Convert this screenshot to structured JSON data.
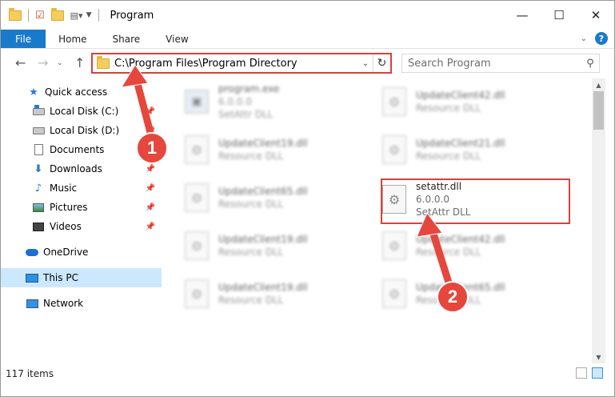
{
  "window": {
    "title": "Program",
    "minimize": "—",
    "maximize": "☐",
    "close": "✕"
  },
  "ribbon": {
    "tabs": [
      "File",
      "Home",
      "Share",
      "View"
    ],
    "collapse_icon": "chevron-down-icon",
    "help": "?"
  },
  "address": {
    "path": "C:\\Program Files\\Program Directory",
    "search_placeholder": "Search Program"
  },
  "sidebar": {
    "items": [
      {
        "label": "Quick access",
        "icon": "star-icon"
      },
      {
        "label": "Local Disk (C:)",
        "icon": "disk-c-icon",
        "pinned": true
      },
      {
        "label": "Local Disk (D:)",
        "icon": "disk-d-icon",
        "pinned": true
      },
      {
        "label": "Documents",
        "icon": "documents-icon",
        "pinned": true
      },
      {
        "label": "Downloads",
        "icon": "downloads-icon",
        "pinned": true
      },
      {
        "label": "Music",
        "icon": "music-icon",
        "pinned": true
      },
      {
        "label": "Pictures",
        "icon": "pictures-icon",
        "pinned": true
      },
      {
        "label": "Videos",
        "icon": "videos-icon",
        "pinned": true
      },
      {
        "label": "OneDrive",
        "icon": "onedrive-icon"
      },
      {
        "label": "This PC",
        "icon": "this-pc-icon",
        "selected": true
      },
      {
        "label": "Network",
        "icon": "network-icon"
      }
    ]
  },
  "files": [
    {
      "name": "program.exe",
      "line2": "6.0.0.0",
      "line3": "SetAttr DLL"
    },
    {
      "name": "UpdateClient42.dll",
      "line2": "Resource DLL"
    },
    {
      "name": "UpdateClient19.dll",
      "line2": "Resource DLL"
    },
    {
      "name": "UpdateClient21.dll",
      "line2": "Resource DLL"
    },
    {
      "name": "UpdateClient65.dll",
      "line2": "Resource DLL"
    },
    {
      "name": "setattr.dll",
      "line2": "6.0.0.0",
      "line3": "SetAttr DLL"
    },
    {
      "name": "UpdateClient19.dll",
      "line2": "Resource DLL"
    },
    {
      "name": "UpdateClient42.dll",
      "line2": "Resource DLL"
    },
    {
      "name": "UpdateClient19.dll",
      "line2": "Resource DLL"
    },
    {
      "name": "UpdateClient65.dll",
      "line2": "Resource DLL"
    }
  ],
  "status": {
    "count": "117 items"
  },
  "annotations": {
    "badge1": "1",
    "badge2": "2",
    "color": "#e5473d"
  }
}
